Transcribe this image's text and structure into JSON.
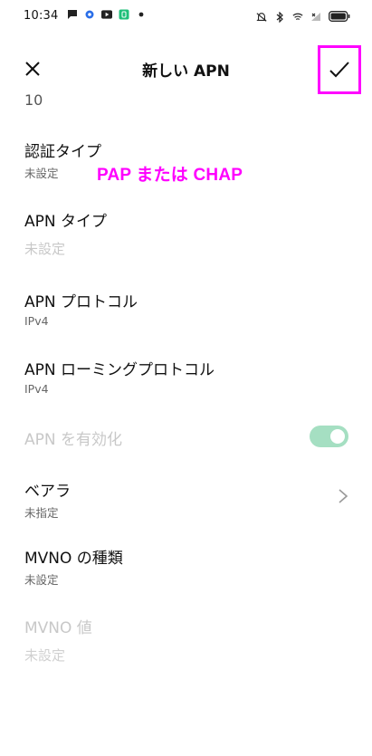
{
  "status_bar": {
    "time": "10:34",
    "icons_left": [
      "message-icon",
      "settings-gear-icon",
      "youtube-icon",
      "app-icon",
      "dot-icon"
    ],
    "icons_right": [
      "mute-icon",
      "bluetooth-icon",
      "wifi-icon",
      "signal-icon",
      "battery-icon"
    ]
  },
  "header": {
    "title": "新しい APN",
    "close_icon": "close-icon",
    "confirm_icon": "check-icon",
    "highlight_color": "#ff00ff"
  },
  "partial_value": "10",
  "annotation": "PAP または CHAP",
  "settings": [
    {
      "label": "認証タイプ",
      "value": "未設定"
    },
    {
      "label": "APN タイプ",
      "value": "未設定",
      "placeholder": true
    },
    {
      "label": "APN プロトコル",
      "value": "IPv4"
    },
    {
      "label": "APN ローミングプロトコル",
      "value": "IPv4"
    },
    {
      "label": "APN を有効化",
      "toggle_on": true,
      "disabled": true,
      "toggle_color": "#a5dfc2"
    },
    {
      "label": "ベアラ",
      "value": "未指定",
      "chevron": "chevron-right-icon"
    },
    {
      "label": "MVNO の種類",
      "value": "未設定"
    },
    {
      "label": "MVNO 値",
      "value": "未設定",
      "disabled": true
    }
  ]
}
